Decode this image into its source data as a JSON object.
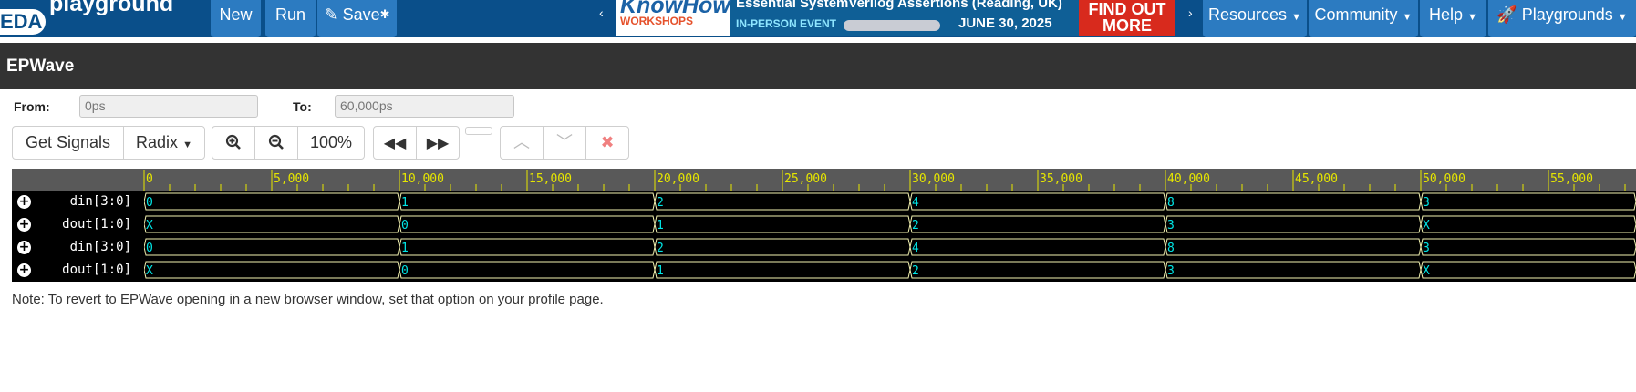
{
  "nav": {
    "logo_short": "EDA",
    "logo_text": "playground",
    "new_label": "New",
    "run_label": "Run",
    "save_label": "Save",
    "save_star": "✱",
    "resources_label": "Resources",
    "community_label": "Community",
    "help_label": "Help",
    "playgrounds_label": "Playgrounds"
  },
  "banner": {
    "brand_main": "KnowHow",
    "brand_sub": "WORKSHOPS",
    "headline": "Essential SystemVerilog Assertions (Reading, UK)",
    "event_type": "IN-PERSON EVENT",
    "date": "JUNE 30, 2025",
    "cta": "FIND OUT MORE"
  },
  "panel": {
    "title": "EPWave"
  },
  "range": {
    "from_label": "From:",
    "from_value": "0ps",
    "to_label": "To:",
    "to_value": "60,000ps"
  },
  "toolbar": {
    "get_signals_label": "Get Signals",
    "radix_label": "Radix",
    "zoom_level": "100%"
  },
  "waveform": {
    "time_min": 0,
    "time_max": 59000,
    "ruler_labels": [
      "0",
      "5,000",
      "10,000",
      "15,000",
      "20,000",
      "25,000",
      "30,000",
      "35,000",
      "40,000",
      "45,000",
      "50,000",
      "55,000"
    ],
    "label_times": [
      0,
      5000,
      10000,
      15000,
      20000,
      25000,
      30000,
      35000,
      40000,
      45000,
      50000,
      55000
    ],
    "signals": [
      {
        "name": "din[3:0]",
        "times": [
          0,
          10000,
          20000,
          30000,
          40000,
          50000
        ],
        "values": [
          "0",
          "1",
          "2",
          "4",
          "8",
          "3"
        ]
      },
      {
        "name": "dout[1:0]",
        "times": [
          0,
          10000,
          20000,
          30000,
          40000,
          50000
        ],
        "values": [
          "X",
          "0",
          "1",
          "2",
          "3",
          "X"
        ]
      },
      {
        "name": "din[3:0]",
        "times": [
          0,
          10000,
          20000,
          30000,
          40000,
          50000
        ],
        "values": [
          "0",
          "1",
          "2",
          "4",
          "8",
          "3"
        ]
      },
      {
        "name": "dout[1:0]",
        "times": [
          0,
          10000,
          20000,
          30000,
          40000,
          50000
        ],
        "values": [
          "X",
          "0",
          "1",
          "2",
          "3",
          "X"
        ]
      }
    ]
  },
  "colors": {
    "nav_bg": "#0a4f8a",
    "nav_button": "#2c7bc1",
    "wave_line": "#f2f2b0",
    "wave_value": "#00e5e5",
    "ruler_tick": "#e6e600"
  },
  "note": "Note: To revert to EPWave opening in a new browser window, set that option on your profile page."
}
